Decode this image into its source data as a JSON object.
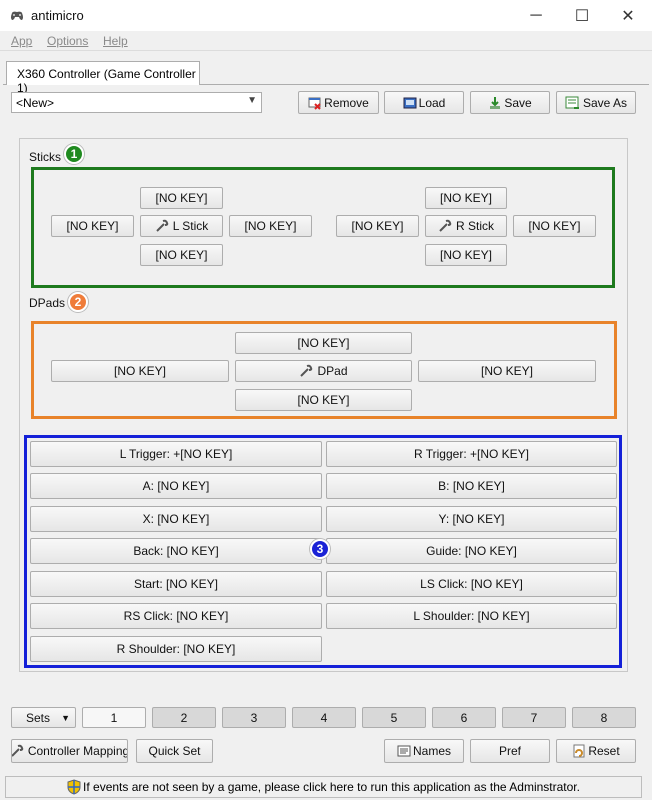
{
  "window": {
    "title": "antimicro",
    "minimize": "─",
    "maximize": "☐",
    "close": "✕"
  },
  "menu": [
    "App",
    "Options",
    "Help"
  ],
  "tab": {
    "label": "X360 Controller (Game Controller 1)"
  },
  "profile": {
    "selected": "<New>",
    "remove_label": "Remove",
    "load_label": "Load",
    "save_label": "Save",
    "save_as_label": "Save As"
  },
  "sticks": {
    "label": "Sticks",
    "badge": "1",
    "left": {
      "up": "[NO KEY]",
      "left": "[NO KEY]",
      "center": "L Stick",
      "right": "[NO KEY]",
      "down": "[NO KEY]"
    },
    "right": {
      "up": "[NO KEY]",
      "left": "[NO KEY]",
      "center": "R Stick",
      "right": "[NO KEY]",
      "down": "[NO KEY]"
    }
  },
  "dpads": {
    "label": "DPads",
    "badge": "2",
    "up": "[NO KEY]",
    "left": "[NO KEY]",
    "center": "DPad",
    "right": "[NO KEY]",
    "down": "[NO KEY]"
  },
  "buttons": {
    "badge": "3",
    "items": [
      "L Trigger: +[NO KEY]",
      "R Trigger: +[NO KEY]",
      "A: [NO KEY]",
      "B: [NO KEY]",
      "X: [NO KEY]",
      "Y: [NO KEY]",
      "Back: [NO KEY]",
      "Guide: [NO KEY]",
      "Start: [NO KEY]",
      "LS Click: [NO KEY]",
      "RS Click: [NO KEY]",
      "L Shoulder: [NO KEY]",
      "R Shoulder: [NO KEY]"
    ]
  },
  "sets": {
    "label": "Sets",
    "items": [
      "1",
      "2",
      "3",
      "4",
      "5",
      "6",
      "7",
      "8"
    ]
  },
  "bottom": {
    "controller_mapping": "Controller Mapping",
    "quick_set": "Quick Set",
    "names": "Names",
    "pref": "Pref",
    "reset": "Reset"
  },
  "status": "If events are not seen by a game, please click here to run this application as the Adminstrator.",
  "colors": {
    "sticks_highlight": "#1e7a1e",
    "dpads_highlight": "#e8832a",
    "buttons_highlight": "#1420d8",
    "badge_green": "#1f8a1f",
    "badge_orange": "#ef7c3a",
    "badge_blue": "#1a22d6"
  }
}
